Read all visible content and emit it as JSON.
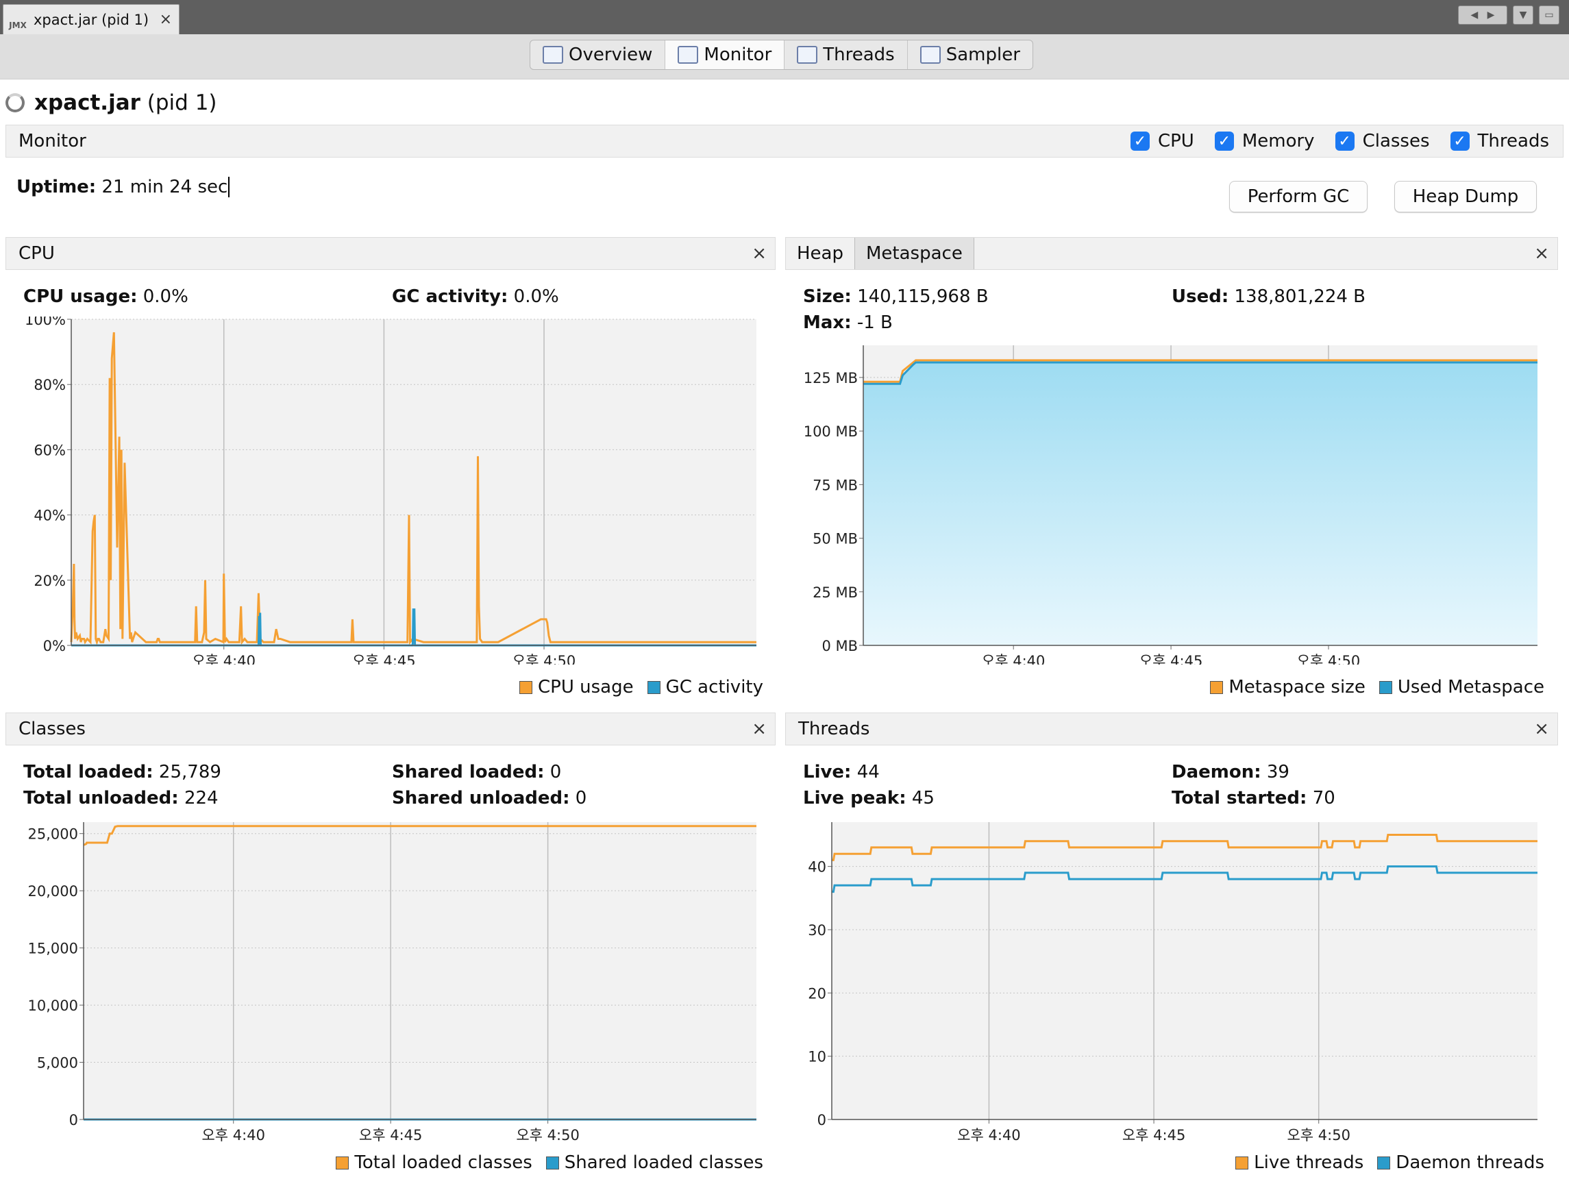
{
  "window": {
    "doc_tab_label": "xpact.jar (pid 1)",
    "doc_tab_icon": "jmx-icon",
    "close_glyph": "×"
  },
  "view_tabs": [
    {
      "label": "Overview",
      "icon": "overview-icon"
    },
    {
      "label": "Monitor",
      "icon": "monitor-icon",
      "active": true
    },
    {
      "label": "Threads",
      "icon": "threads-icon"
    },
    {
      "label": "Sampler",
      "icon": "sampler-icon"
    }
  ],
  "app": {
    "name": "xpact.jar",
    "pid": "(pid 1)"
  },
  "monitor": {
    "label": "Monitor",
    "checkboxes": [
      {
        "label": "CPU",
        "checked": true
      },
      {
        "label": "Memory",
        "checked": true
      },
      {
        "label": "Classes",
        "checked": true
      },
      {
        "label": "Threads",
        "checked": true
      }
    ],
    "uptime_label": "Uptime:",
    "uptime_value": "21 min 24 sec",
    "perform_gc": "Perform GC",
    "heap_dump": "Heap Dump"
  },
  "colors": {
    "series_orange": "#f5a033",
    "series_blue": "#2a9ccb",
    "area_blue": "#9edcf2"
  },
  "cpu_panel": {
    "title": "CPU",
    "stats": [
      {
        "label": "CPU usage:",
        "value": "0.0%"
      },
      {
        "label": "GC activity:",
        "value": "0.0%"
      }
    ],
    "legend": [
      "CPU usage",
      "GC activity"
    ]
  },
  "memory_panel": {
    "tabs": [
      "Heap",
      "Metaspace"
    ],
    "active_tab": "Metaspace",
    "stats": [
      {
        "label": "Size:",
        "value": "140,115,968 B"
      },
      {
        "label": "Used:",
        "value": "138,801,224 B"
      },
      {
        "label": "Max:",
        "value": "-1 B"
      }
    ],
    "legend": [
      "Metaspace size",
      "Used Metaspace"
    ]
  },
  "classes_panel": {
    "title": "Classes",
    "stats": [
      {
        "label": "Total loaded:",
        "value": "25,789"
      },
      {
        "label": "Shared loaded:",
        "value": "0"
      },
      {
        "label": "Total unloaded:",
        "value": "224"
      },
      {
        "label": "Shared unloaded:",
        "value": "0"
      }
    ],
    "legend": [
      "Total loaded classes",
      "Shared loaded classes"
    ]
  },
  "threads_panel": {
    "title": "Threads",
    "stats": [
      {
        "label": "Live:",
        "value": "44"
      },
      {
        "label": "Daemon:",
        "value": "39"
      },
      {
        "label": "Live peak:",
        "value": "45"
      },
      {
        "label": "Total started:",
        "value": "70"
      }
    ],
    "legend": [
      "Live threads",
      "Daemon threads"
    ]
  },
  "chart_data": [
    {
      "id": "cpu",
      "type": "line",
      "x_ticks": [
        "오후 4:40",
        "오후 4:45",
        "오후 4:50"
      ],
      "y_ticks": [
        "0%",
        "20%",
        "40%",
        "60%",
        "80%",
        "100%"
      ],
      "ylim": [
        0,
        100
      ],
      "xlim": [
        0,
        1284
      ],
      "x_tick_values": [
        286,
        586,
        886
      ],
      "series": [
        {
          "name": "CPU usage",
          "x": [
            0,
            3,
            5,
            6,
            7,
            9,
            12,
            16,
            18,
            20,
            22,
            24,
            26,
            30,
            36,
            40,
            42,
            44,
            46,
            48,
            50,
            52,
            55,
            60,
            62,
            64,
            66,
            70,
            72,
            74,
            76,
            80,
            86,
            90,
            92,
            94,
            96,
            100,
            110,
            112,
            114,
            116,
            120,
            140,
            150,
            160,
            162,
            164,
            166,
            170,
            200,
            232,
            234,
            236,
            240,
            245,
            249,
            251,
            253,
            260,
            270,
            285,
            286,
            288,
            291,
            295,
            315,
            318,
            320,
            325,
            330,
            348,
            351,
            354,
            360,
            380,
            384,
            388,
            392,
            410,
            420,
            510,
            525,
            527,
            529,
            533,
            540,
            630,
            633,
            635,
            640,
            660,
            730,
            760,
            762,
            764,
            766,
            770,
            800,
            880,
            890,
            892,
            895,
            898,
            900,
            960,
            1100,
            1284
          ],
          "y": [
            1,
            12,
            25,
            8,
            2,
            4,
            2,
            3,
            1,
            2,
            2,
            2,
            1,
            2,
            1,
            35,
            38,
            40,
            2,
            1,
            2,
            2,
            1,
            1,
            3,
            5,
            3,
            2,
            82,
            20,
            88,
            96,
            30,
            64,
            5,
            60,
            2,
            56,
            2,
            4,
            1,
            2,
            4,
            1,
            1,
            1,
            2,
            2,
            1,
            1,
            1,
            1,
            12,
            1,
            1,
            1,
            4,
            20,
            2,
            1,
            2,
            1,
            22,
            1,
            2,
            1,
            1,
            12,
            1,
            2,
            1,
            1,
            16,
            2,
            1,
            1,
            5,
            2,
            2,
            1,
            1,
            1,
            1,
            8,
            1,
            1,
            1,
            1,
            40,
            1,
            2,
            1,
            1,
            1,
            58,
            12,
            2,
            1,
            1,
            8,
            8,
            7,
            3,
            1,
            1,
            1,
            1,
            1
          ]
        },
        {
          "name": "GC activity",
          "x": [
            0,
            350,
            351,
            352,
            353,
            354,
            355,
            356,
            357,
            360,
            640,
            641,
            642,
            643,
            644,
            650,
            1284
          ],
          "y": [
            0,
            0,
            0,
            9,
            0,
            10,
            0,
            0,
            0,
            0,
            0,
            11,
            11,
            11,
            0,
            0,
            0
          ]
        }
      ]
    },
    {
      "id": "metaspace",
      "type": "area",
      "x_ticks": [
        "오후 4:40",
        "오후 4:45",
        "오후 4:50"
      ],
      "y_ticks": [
        "0 MB",
        "25 MB",
        "50 MB",
        "75 MB",
        "100 MB",
        "125 MB"
      ],
      "ylim": [
        0,
        140
      ],
      "xlim": [
        0,
        1284
      ],
      "x_tick_values": [
        286,
        586,
        886
      ],
      "series": [
        {
          "name": "Metaspace size",
          "x": [
            0,
            70,
            75,
            95,
            100,
            1284
          ],
          "y": [
            123,
            123,
            128,
            132,
            133,
            133
          ]
        },
        {
          "name": "Used Metaspace",
          "x": [
            0,
            70,
            75,
            95,
            100,
            1284
          ],
          "y": [
            122,
            122,
            126,
            131,
            132,
            132
          ]
        }
      ]
    },
    {
      "id": "classes",
      "type": "line",
      "x_ticks": [
        "오후 4:40",
        "오후 4:45",
        "오후 4:50"
      ],
      "y_ticks": [
        "0",
        "5,000",
        "10,000",
        "15,000",
        "20,000",
        "25,000"
      ],
      "ylim": [
        0,
        26000
      ],
      "xlim": [
        0,
        1284
      ],
      "x_tick_values": [
        286,
        586,
        886
      ],
      "series": [
        {
          "name": "Total loaded classes",
          "x": [
            0,
            5,
            6,
            45,
            50,
            54,
            60,
            65,
            1284
          ],
          "y": [
            24000,
            24100,
            24200,
            24200,
            25000,
            25000,
            25600,
            25650,
            25650
          ]
        },
        {
          "name": "Shared loaded classes",
          "x": [
            0,
            1284
          ],
          "y": [
            0,
            0
          ]
        }
      ]
    },
    {
      "id": "threads",
      "type": "line",
      "x_ticks": [
        "오후 4:40",
        "오후 4:45",
        "오후 4:50"
      ],
      "y_ticks": [
        "0",
        "10",
        "20",
        "30",
        "40"
      ],
      "ylim": [
        0,
        47
      ],
      "xlim": [
        0,
        1284
      ],
      "x_tick_values": [
        286,
        586,
        886
      ],
      "series": [
        {
          "name": "Live threads",
          "x": [
            0,
            3,
            5,
            70,
            72,
            145,
            147,
            180,
            182,
            350,
            352,
            430,
            432,
            600,
            602,
            720,
            722,
            890,
            892,
            900,
            902,
            910,
            912,
            950,
            952,
            960,
            962,
            1010,
            1012,
            1100,
            1102,
            1284
          ],
          "y": [
            41,
            41,
            42,
            42,
            43,
            43,
            42,
            42,
            43,
            43,
            44,
            44,
            43,
            43,
            44,
            44,
            43,
            43,
            44,
            44,
            43,
            43,
            44,
            44,
            43,
            43,
            44,
            44,
            45,
            45,
            44,
            44
          ]
        },
        {
          "name": "Daemon threads",
          "x": [
            0,
            3,
            5,
            70,
            72,
            145,
            147,
            180,
            182,
            350,
            352,
            430,
            432,
            600,
            602,
            720,
            722,
            890,
            892,
            900,
            902,
            910,
            912,
            950,
            952,
            960,
            962,
            1010,
            1012,
            1100,
            1102,
            1284
          ],
          "y": [
            36,
            36,
            37,
            37,
            38,
            38,
            37,
            37,
            38,
            38,
            39,
            39,
            38,
            38,
            39,
            39,
            38,
            38,
            39,
            39,
            38,
            38,
            39,
            39,
            38,
            38,
            39,
            39,
            40,
            40,
            39,
            39
          ]
        }
      ]
    }
  ]
}
